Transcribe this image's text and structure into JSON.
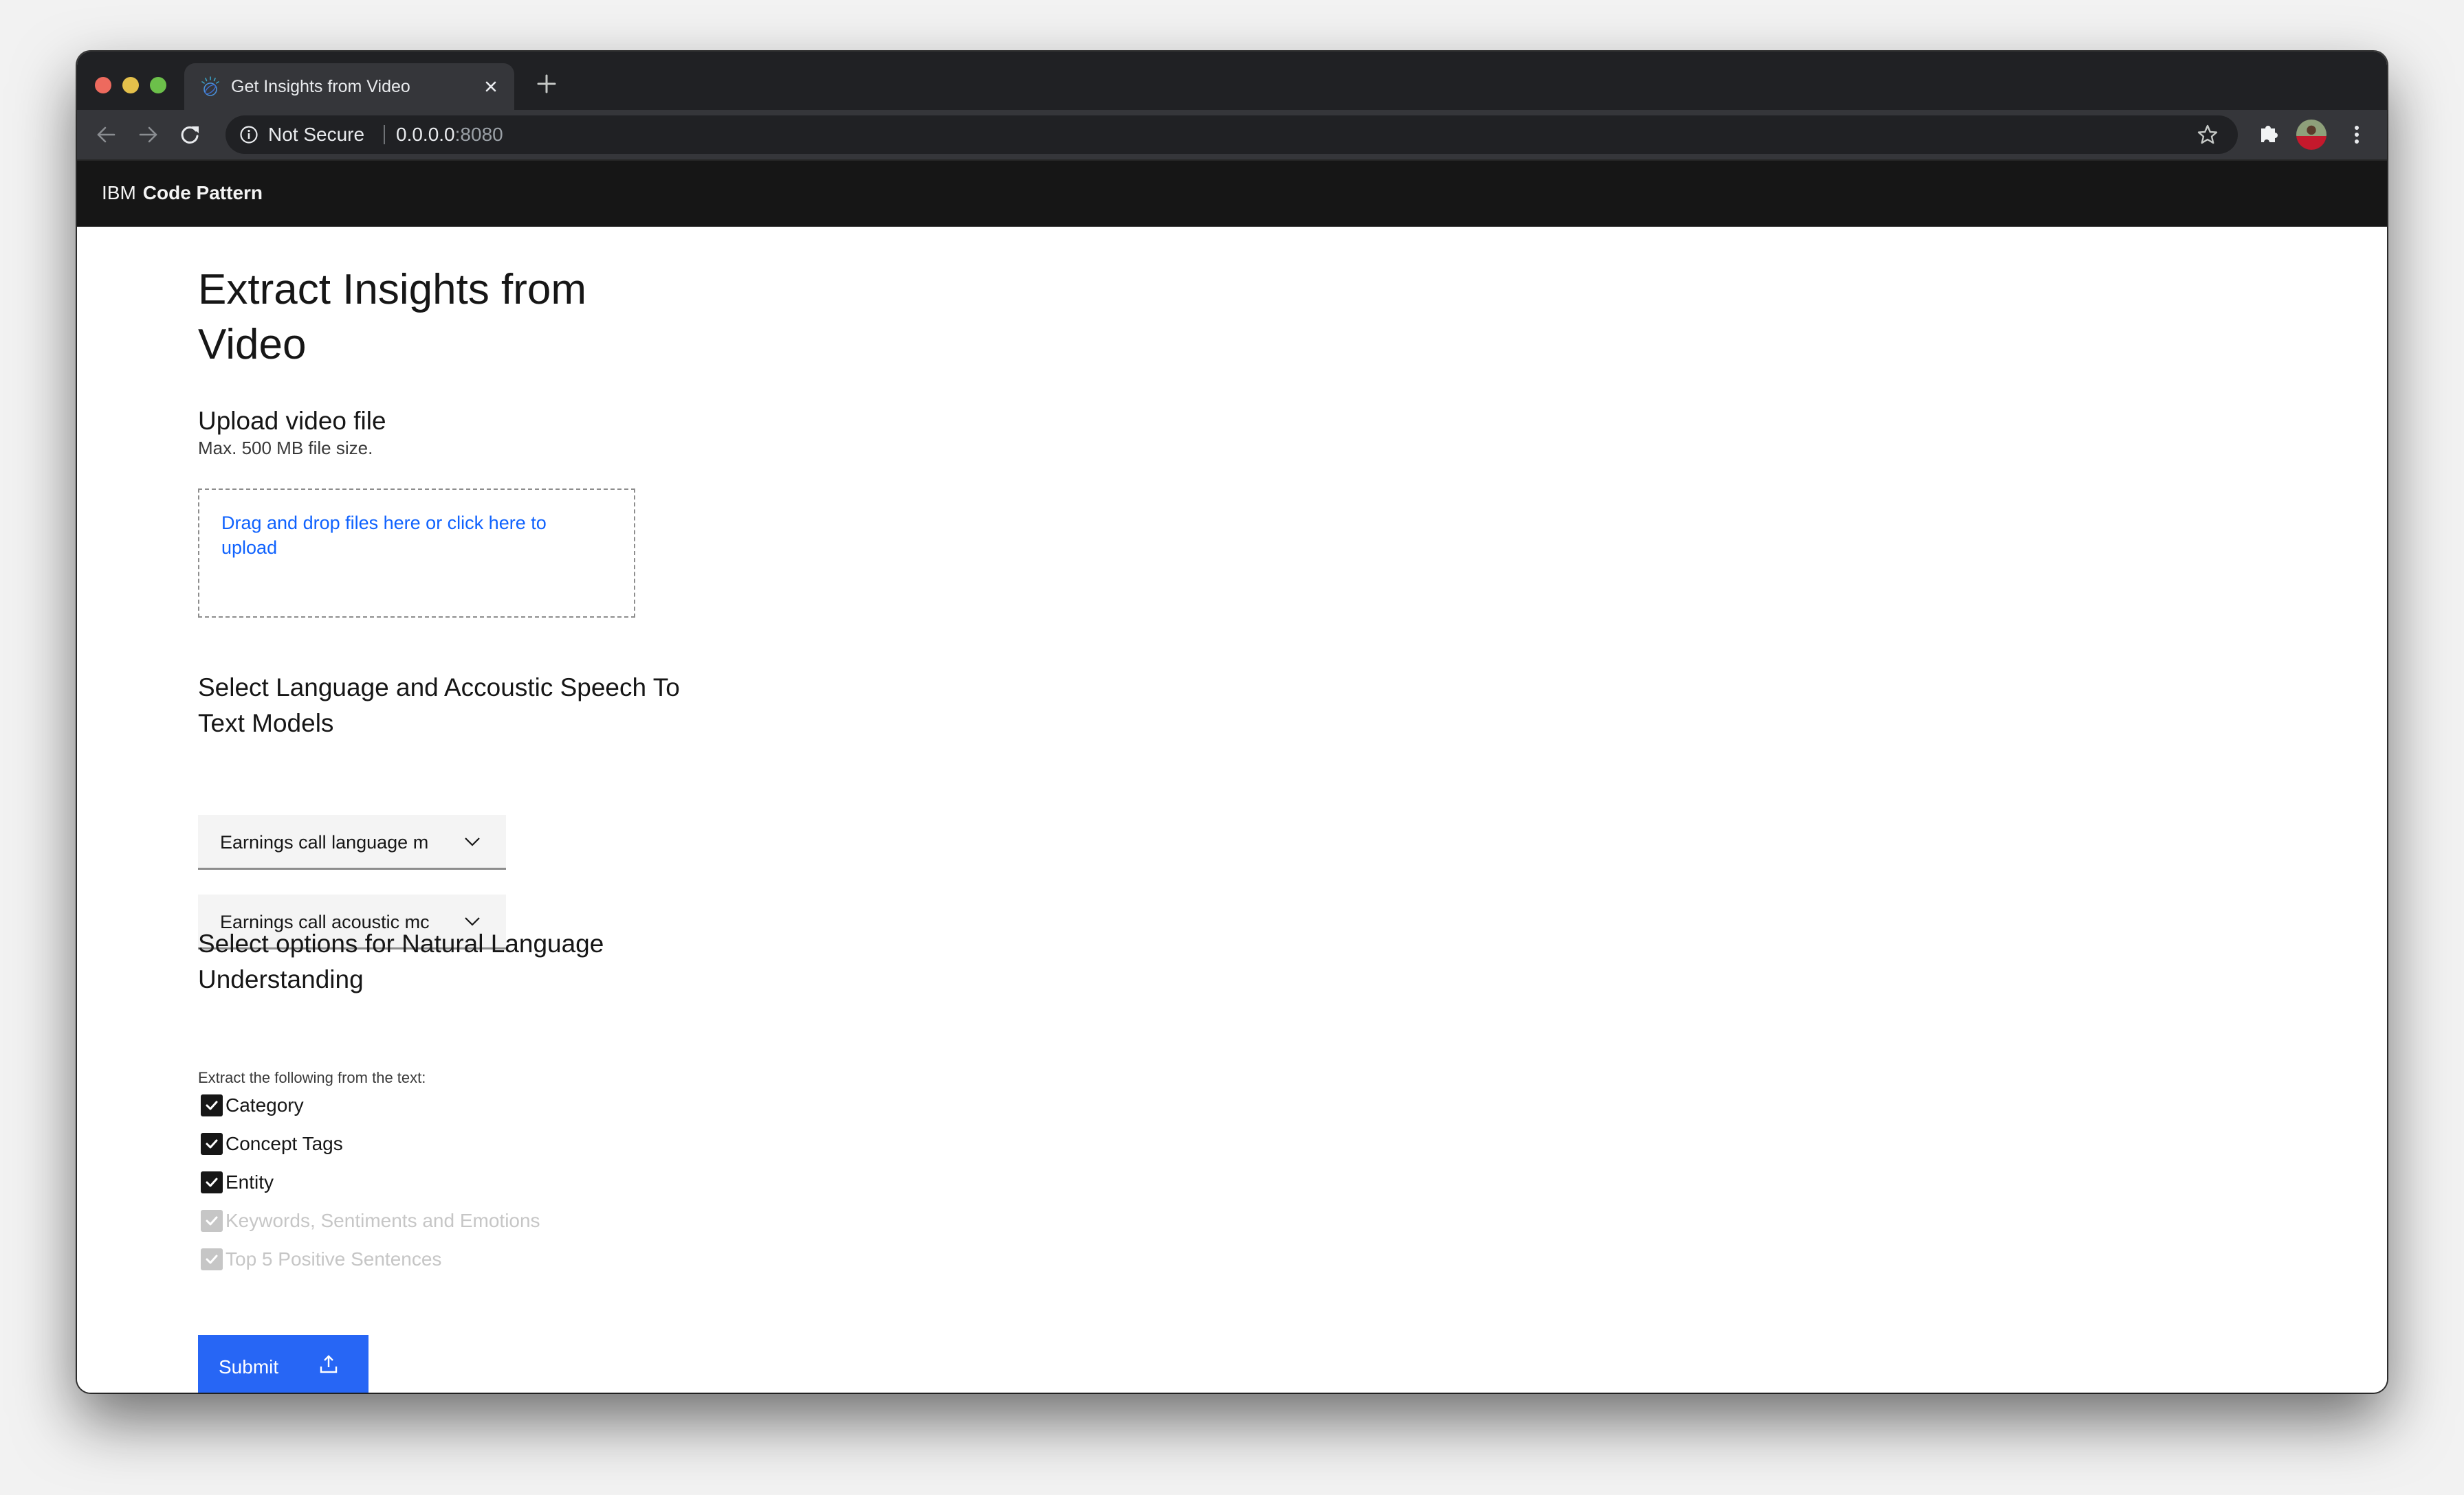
{
  "browser": {
    "tab": {
      "title": "Get Insights from Video",
      "favicon": "ibm-watson-icon",
      "close_label": "×"
    },
    "new_tab_label": "+",
    "nav": {
      "back": "arrow-left-icon",
      "forward": "arrow-right-icon",
      "reload": "reload-icon"
    },
    "omnibox": {
      "security_label": "Not Secure",
      "url_host": "0.0.0.0",
      "url_port": ":8080"
    },
    "toolbar_icons": [
      "star-icon",
      "puzzle-icon",
      "avatar",
      "kebab-menu-icon"
    ]
  },
  "header": {
    "brand_light": "IBM",
    "brand_bold": "Code Pattern"
  },
  "main": {
    "title": "Extract Insights from Video",
    "upload": {
      "title": "Upload video file",
      "subtitle": "Max. 500 MB file size.",
      "dropzone_text": "Drag and drop files here or click here to upload"
    },
    "stt": {
      "title": "Select Language and Accoustic Speech To Text Models",
      "language_model": "Earnings call language m",
      "acoustic_model": "Earnings call acoustic mc"
    },
    "nlu": {
      "title": "Select options for Natural Language Understanding",
      "label": "Extract the following from the text:",
      "options": [
        {
          "label": "Category",
          "checked": true,
          "disabled": false
        },
        {
          "label": "Concept Tags",
          "checked": true,
          "disabled": false
        },
        {
          "label": "Entity",
          "checked": true,
          "disabled": false
        },
        {
          "label": "Keywords, Sentiments and Emotions",
          "checked": true,
          "disabled": true
        },
        {
          "label": "Top 5 Positive Sentences",
          "checked": true,
          "disabled": true
        }
      ]
    },
    "submit_label": "Submit"
  },
  "colors": {
    "primary": "#0f62fe",
    "button": "#2766f5",
    "header_bg": "#161616",
    "disabled": "#c6c6c6"
  }
}
